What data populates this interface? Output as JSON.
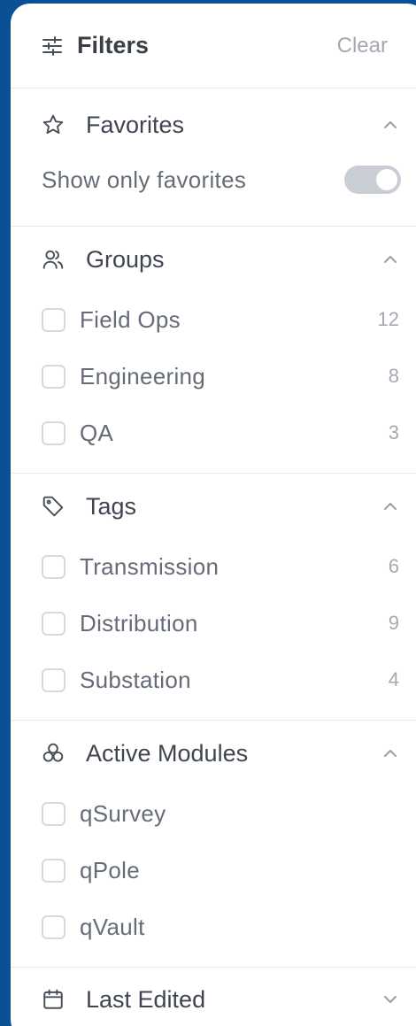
{
  "header": {
    "title": "Filters",
    "clear_label": "Clear"
  },
  "favorites": {
    "title": "Favorites",
    "toggle_label": "Show only favorites",
    "toggle_on": false
  },
  "groups": {
    "title": "Groups",
    "items": [
      {
        "label": "Field Ops",
        "count": "12"
      },
      {
        "label": "Engineering",
        "count": "8"
      },
      {
        "label": "QA",
        "count": "3"
      }
    ]
  },
  "tags": {
    "title": "Tags",
    "items": [
      {
        "label": "Transmission",
        "count": "6"
      },
      {
        "label": "Distribution",
        "count": "9"
      },
      {
        "label": "Substation",
        "count": "4"
      }
    ]
  },
  "modules": {
    "title": "Active Modules",
    "items": [
      {
        "label": "qSurvey"
      },
      {
        "label": "qPole"
      },
      {
        "label": "qVault"
      }
    ]
  },
  "last_edited": {
    "title": "Last Edited"
  },
  "icons": {
    "header": "sliders-icon",
    "favorites": "star-icon",
    "groups": "users-icon",
    "tags": "tag-icon",
    "modules": "modules-icon",
    "last_edited": "calendar-icon"
  },
  "colors": {
    "background": "#0b4f94",
    "panel": "#ffffff",
    "text": "#3f4550",
    "muted": "#a4a9b1"
  }
}
